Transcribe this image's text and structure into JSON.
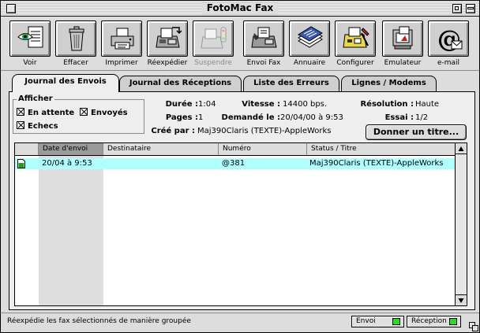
{
  "window": {
    "title": "FotoMac Fax"
  },
  "toolbar": [
    {
      "label": "Voir",
      "icon": "eye-document-icon",
      "enabled": true
    },
    {
      "label": "Effacer",
      "icon": "trash-can-icon",
      "enabled": true
    },
    {
      "label": "Imprimer",
      "icon": "printer-icon",
      "enabled": true
    },
    {
      "label": "Réexpédier",
      "icon": "fax-resend-icon",
      "enabled": true
    },
    {
      "label": "Suspendre",
      "icon": "fax-suspend-icon",
      "enabled": false
    },
    {
      "label": "Envoi Fax",
      "icon": "fax-machine-icon",
      "enabled": true
    },
    {
      "label": "Annuaire",
      "icon": "directory-cards-icon",
      "enabled": true
    },
    {
      "label": "Configurer",
      "icon": "configure-fax-icon",
      "enabled": true
    },
    {
      "label": "Emulateur",
      "icon": "emulator-icon",
      "enabled": true
    },
    {
      "label": "e-mail",
      "icon": "email-at-icon",
      "enabled": true
    }
  ],
  "tabs": [
    {
      "label": "Journal des Envois",
      "active": true
    },
    {
      "label": "Journal des Réceptions",
      "active": false
    },
    {
      "label": "Liste des Erreurs",
      "active": false
    },
    {
      "label": "Lignes / Modems",
      "active": false
    }
  ],
  "afficher": {
    "title": "Afficher",
    "en_attente": "En attente",
    "envoyes": "Envoyés",
    "echecs": "Echecs"
  },
  "details": {
    "duree_label": "Durée :",
    "duree_value": "1:04",
    "vitesse_label": "Vitesse :",
    "vitesse_value": "14400 bps.",
    "resolution_label": "Résolution :",
    "resolution_value": "Haute",
    "pages_label": "Pages :",
    "pages_value": "1",
    "demande_label": "Demandé le :",
    "demande_value": "20/04/00 à 9:53",
    "essai_label": "Essai :",
    "essai_value": "1/2",
    "cree_label": "Créé par :",
    "cree_value": "Maj390Claris (TEXTE)-AppleWorks",
    "title_button": "Donner un titre..."
  },
  "table": {
    "columns": [
      "Date d'envoi",
      "Destinataire",
      "Numéro",
      "Status / Titre"
    ],
    "rows": [
      {
        "date": "20/04 à 9:53",
        "destinataire": "",
        "numero": "@381",
        "status": "Maj390Claris (TEXTE)-AppleWorks"
      }
    ]
  },
  "statusbar": {
    "text": "Réexpédie les fax sélectionnés de manière groupée",
    "envoi": "Envoi",
    "reception": "Réception",
    "led_color": "#22dd22"
  }
}
